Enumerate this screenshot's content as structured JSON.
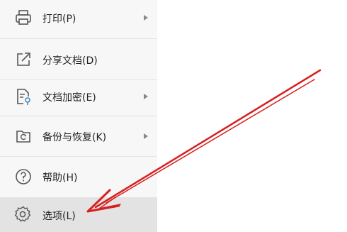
{
  "menu": {
    "items": [
      {
        "label": "打印(P)",
        "icon": "printer-icon",
        "has_submenu": true
      },
      {
        "label": "分享文档(D)",
        "icon": "share-icon",
        "has_submenu": false
      },
      {
        "label": "文档加密(E)",
        "icon": "document-lock-icon",
        "has_submenu": true
      },
      {
        "label": "备份与恢复(K)",
        "icon": "backup-restore-icon",
        "has_submenu": true
      },
      {
        "label": "帮助(H)",
        "icon": "help-icon",
        "has_submenu": false
      },
      {
        "label": "选项(L)",
        "icon": "gear-icon",
        "has_submenu": false,
        "selected": true
      }
    ]
  },
  "colors": {
    "menu_background": "#f7f7f7",
    "selected_background": "#e3e3e3",
    "annotation_arrow": "#d62020",
    "icon_stroke": "#555555"
  }
}
